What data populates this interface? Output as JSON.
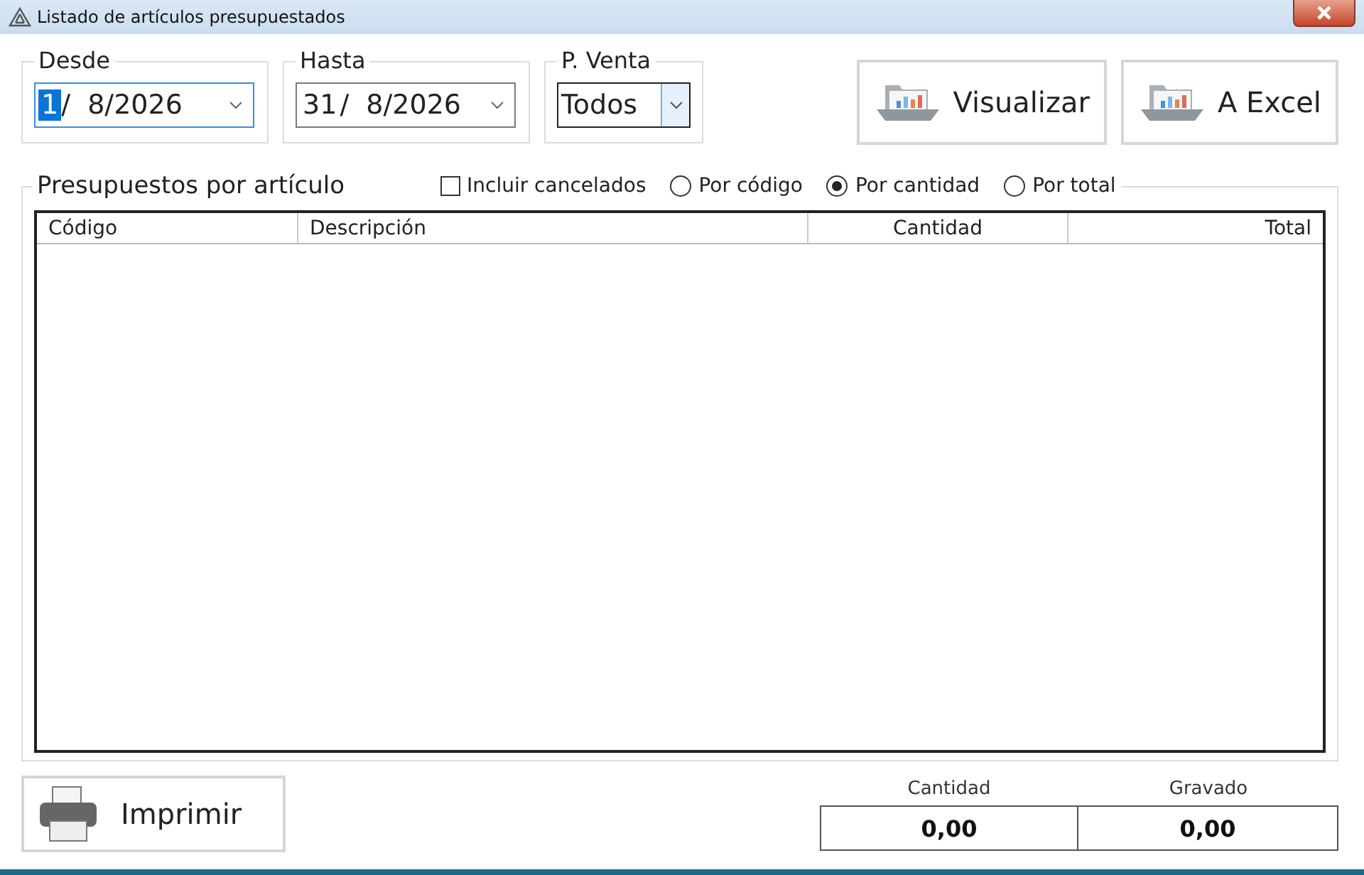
{
  "window": {
    "title": "Listado de artículos presupuestados"
  },
  "filters": [
    {
      "kind": "date",
      "label": "Desde",
      "day": "1",
      "rest": "/  8/2026",
      "focused": true
    },
    {
      "kind": "date",
      "label": "Hasta",
      "day": "31",
      "rest": "/  8/2026",
      "focused": false
    },
    {
      "kind": "select",
      "label": "P. Venta",
      "value": "Todos",
      "focused": true
    }
  ],
  "actions": [
    "Visualizar",
    "A Excel"
  ],
  "group": {
    "title": "Presupuestos por artículo",
    "include_cancelled": {
      "label": "Incluir cancelados",
      "checked": false
    },
    "sort": [
      {
        "label": "Por código",
        "selected": false
      },
      {
        "label": "Por cantidad",
        "selected": true
      },
      {
        "label": "Por total",
        "selected": false
      }
    ]
  },
  "table": {
    "columns": [
      {
        "label": "Código"
      },
      {
        "label": "Descripción"
      },
      {
        "label": "Cantidad"
      },
      {
        "label": "Total"
      }
    ]
  },
  "print_button": "Imprimir",
  "totals": [
    {
      "label": "Cantidad",
      "value": "0,00"
    },
    {
      "label": "Gravado",
      "value": "0,00"
    }
  ]
}
